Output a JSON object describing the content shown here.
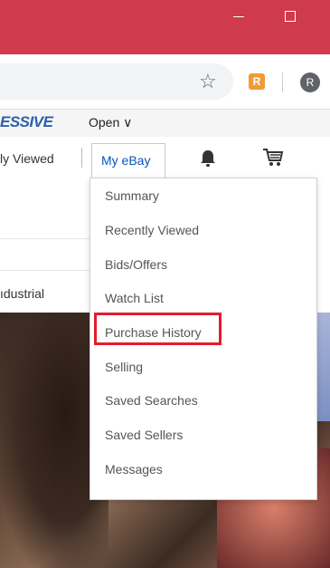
{
  "browser": {
    "extension_label": "R",
    "profile_initial": "R"
  },
  "bookmarks": {
    "brand_text": "ESSIVE",
    "open_label": "Open",
    "open_chevron": "∨"
  },
  "nav": {
    "recently_viewed_partial": "ly Viewed",
    "my_ebay_label": "My eBay",
    "bell_icon": "bell-icon",
    "cart_icon": "cart-icon"
  },
  "page": {
    "category_partial": "ıdustrial"
  },
  "dropdown": {
    "items": [
      {
        "label": "Summary"
      },
      {
        "label": "Recently Viewed"
      },
      {
        "label": "Bids/Offers"
      },
      {
        "label": "Watch List"
      },
      {
        "label": "Purchase History",
        "highlighted": true
      },
      {
        "label": "Selling"
      },
      {
        "label": "Saved Searches"
      },
      {
        "label": "Saved Sellers"
      },
      {
        "label": "Messages"
      }
    ]
  },
  "colors": {
    "titlebar": "#cf3b4b",
    "ebay_link": "#0654ba",
    "highlight_border": "#e41c2c"
  }
}
